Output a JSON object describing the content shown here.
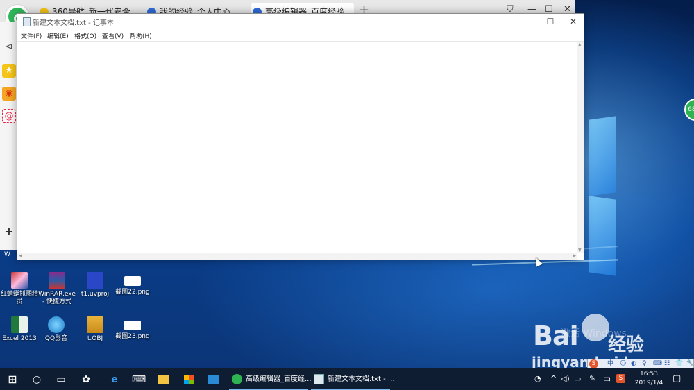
{
  "browser": {
    "tabs": [
      {
        "label": "360导航_新一代安全"
      },
      {
        "label": "我的经验_个人中心"
      },
      {
        "label": "高级编辑器_百度经验"
      }
    ],
    "tab_close": "×",
    "new_tab": "+",
    "controls": {
      "shirt": "⛉",
      "minimize": "—",
      "maximize": "☐",
      "close": "✕"
    },
    "sidebar": {
      "back": "⊲",
      "add": "+"
    }
  },
  "float_badge": "68",
  "notepad": {
    "title": "新建文本文档.txt - 记事本",
    "menu": [
      "文件(F)",
      "编辑(E)",
      "格式(O)",
      "查看(V)",
      "帮助(H)"
    ],
    "controls": {
      "minimize": "—",
      "maximize": "☐",
      "close": "✕"
    },
    "content": ""
  },
  "desktop_icons": [
    {
      "label": "红蜻蜓抓图精灵"
    },
    {
      "label": "WinRAR.exe - 快捷方式"
    },
    {
      "label": "t1.uvproj"
    },
    {
      "label": "截图22.png"
    },
    {
      "label": "Excel 2013"
    },
    {
      "label": "QQ影音"
    },
    {
      "label": "t.OBJ"
    },
    {
      "label": "截图23.png"
    }
  ],
  "peek_labels": [
    "W",
    "W"
  ],
  "watermark": {
    "faded": "激活 Windows",
    "baidu": "Bai",
    "cn": "经验",
    "url": "jingyan.baidu.com"
  },
  "ime_bar": {
    "zh": "中",
    "items": [
      "☺",
      "◐",
      "♀",
      "⌨",
      "☷",
      "👕",
      "🔧"
    ]
  },
  "taskbar": {
    "tasks": [
      {
        "label": "高级编辑器_百度经..."
      },
      {
        "label": "新建文本文档.txt - ..."
      }
    ],
    "tray": {
      "ime": "中",
      "sogou": "S",
      "time": "16:53",
      "date": "2019/1/4"
    }
  },
  "colors": {
    "accent": "#76b9ed",
    "taskbar": "#0f1d33",
    "browser_green": "#2eb352"
  }
}
